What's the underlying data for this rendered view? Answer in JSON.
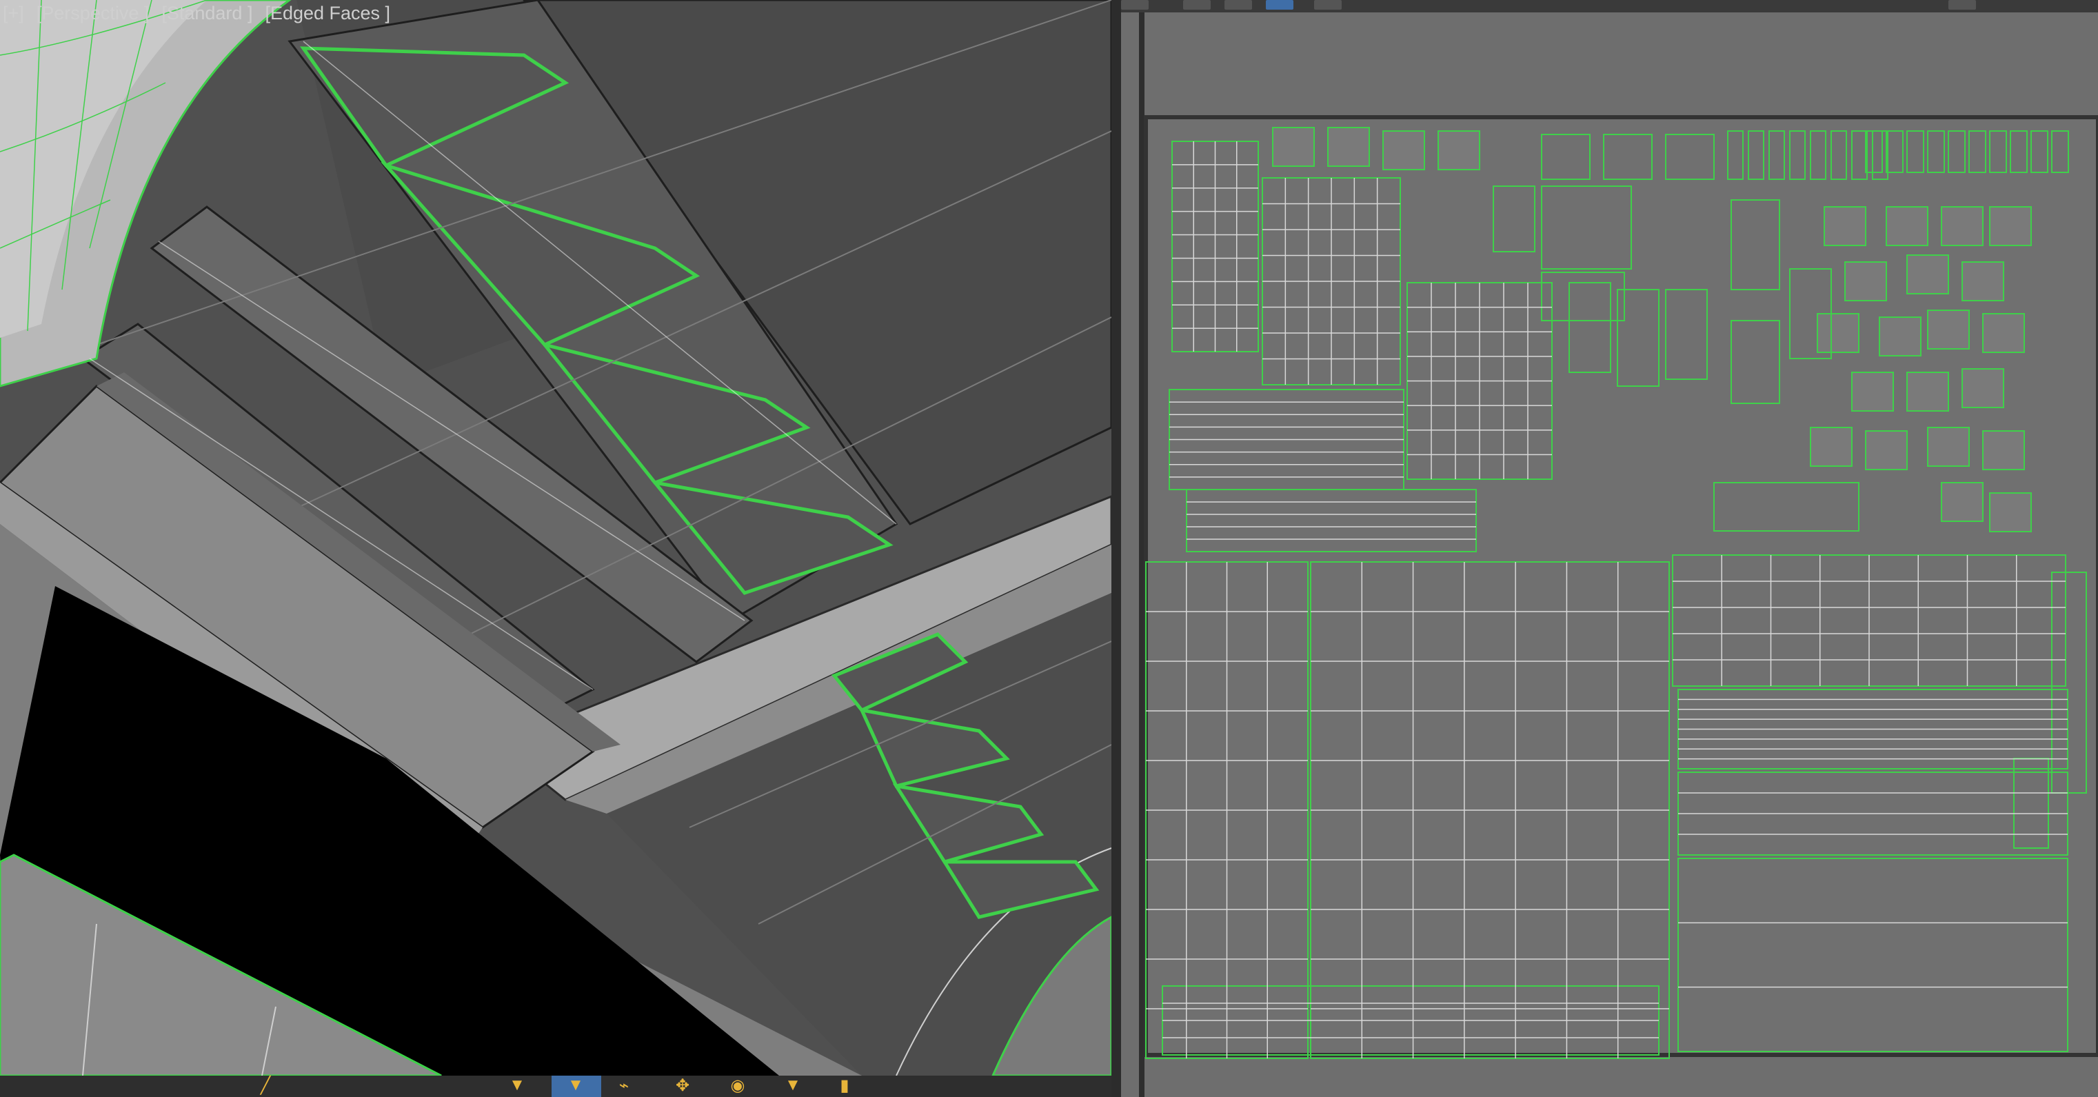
{
  "viewport": {
    "labels": [
      "[+]",
      "[Perspective ]",
      "[Standard ]",
      "[Edged Faces ]"
    ]
  },
  "uv_editor": {
    "background": "#6e6e6e",
    "wire_color": "#3fd04a"
  },
  "toolbar": {
    "icons": [
      "move-icon",
      "filter-icon",
      "filter-icon-2",
      "select-icon",
      "scale-icon",
      "link-icon",
      "eye-icon",
      "pin-icon",
      "lock-icon"
    ]
  },
  "colors": {
    "selection_wire": "#3fd04a",
    "accent": "#3f6ea8",
    "icon_yellow": "#e8b53a"
  }
}
